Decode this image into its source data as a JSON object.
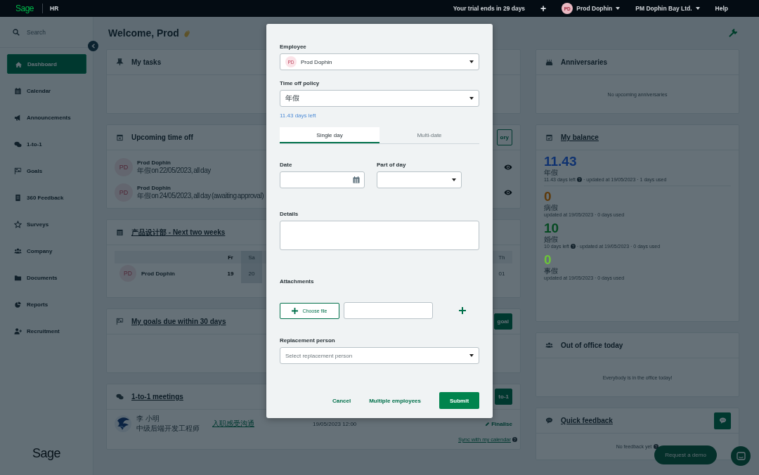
{
  "topbar": {
    "logo": "Sage",
    "product": "HR",
    "trial": "Your trial ends in 29 days",
    "add": "+",
    "user": {
      "initials": "PD",
      "name": "Prod Dophin"
    },
    "company": "PM Dophin Bay Ltd.",
    "help": "Help"
  },
  "sidebar": {
    "search_placeholder": "Search",
    "items": [
      {
        "label": "Dashboard",
        "selected": true
      },
      {
        "label": "Calendar",
        "selected": false
      },
      {
        "label": "Announcements",
        "selected": false
      },
      {
        "label": "1-to-1",
        "selected": false
      },
      {
        "label": "Goals",
        "selected": false
      },
      {
        "label": "360 Feedback",
        "selected": false
      },
      {
        "label": "Surveys",
        "selected": false
      },
      {
        "label": "Company",
        "selected": false
      },
      {
        "label": "Documents",
        "selected": false
      },
      {
        "label": "Reports",
        "selected": false
      },
      {
        "label": "Recruitment",
        "selected": false
      }
    ],
    "footer_logo": "Sage"
  },
  "welcome": "Welcome, Prod",
  "middle_cards": [
    {
      "kind": "tasks",
      "title": "My tasks",
      "link": false
    },
    {
      "kind": "time_off",
      "title": "Upcoming time off",
      "link": false,
      "action": {
        "label": "ory",
        "kind": "outline"
      },
      "rows": [
        {
          "initials": "PD",
          "name": "Prod Dophin",
          "detail": "年假 on 22/05/2023, all day"
        },
        {
          "initials": "PD",
          "name": "Prod Dophin",
          "detail": "年假 on 24/05/2023, all day (awaiting approval)"
        }
      ]
    },
    {
      "kind": "team_calendar",
      "title": "产品设计部 - Next two weeks",
      "link": true,
      "days": [
        {
          "label": "Fr",
          "date": "19",
          "today": true,
          "weekend": false
        },
        {
          "label": "Sa",
          "date": "20",
          "today": false,
          "weekend": true
        },
        {
          "label": "Th",
          "date": "01",
          "today": false,
          "weekend": false
        }
      ],
      "rows": [
        {
          "initials": "PD",
          "name": "Prod Dophin"
        }
      ]
    },
    {
      "kind": "goals",
      "title": "My goals due within 30 days",
      "link": true,
      "action": {
        "label": "goal",
        "kind": "filled"
      }
    },
    {
      "kind": "meetings",
      "title": "1-to-1 meetings",
      "link": true,
      "action": {
        "label": "to-1",
        "kind": "filled"
      },
      "rows": [
        {
          "name": "李 小明",
          "role": "中级后端开发工程师",
          "topic": "入职感受沟通",
          "time": "19/05/2023 12:00",
          "status": "Finalise"
        }
      ],
      "sync": "Sync with my calendar"
    }
  ],
  "right_cards": [
    {
      "kind": "anniversaries",
      "title": "Anniversaries",
      "link": false,
      "empty": "No upcoming anniversaries"
    },
    {
      "kind": "balance",
      "title": "My balance",
      "link": true,
      "entries": [
        {
          "amount": "11.43",
          "color": "#0f3270",
          "policy": "年假",
          "days_left": "11.43 days left",
          "updated": "· updated at 19/05/2023 · 1 days used"
        },
        {
          "amount": "0",
          "color": "#5e3a0c",
          "policy": "病假",
          "updated": "updated at 19/05/2023 · 0 days used"
        },
        {
          "amount": "10",
          "color": "#064a22",
          "policy": "婚假",
          "days_left": "10 days left",
          "updated": "· updated at 19/05/2023 · 0 days used"
        },
        {
          "amount": "0",
          "color": "#6cc43a",
          "policy": "事假",
          "updated": "updated at 19/05/2023 · 0 days used"
        }
      ]
    },
    {
      "kind": "out_of_office",
      "title": "Out of office today",
      "link": false,
      "empty": "Everybody is in the office today!"
    },
    {
      "kind": "feedback",
      "title": "Quick feedback",
      "link": true,
      "empty": "No feedback yet"
    }
  ],
  "request_demo": "Request a demo",
  "dialog": {
    "employee": {
      "label": "Employee",
      "initials": "PD",
      "value": "Prod Dophin"
    },
    "policy": {
      "label": "Time off policy",
      "value": "年假",
      "hint": "11.43 days left"
    },
    "tabs": [
      {
        "label": "Single day",
        "selected": true
      },
      {
        "label": "Multi-date",
        "selected": false
      }
    ],
    "date": {
      "label": "Date"
    },
    "part_of_day": {
      "label": "Part of day"
    },
    "details": {
      "label": "Details"
    },
    "attachments": {
      "label": "Attachments",
      "button": "Choose file"
    },
    "replacement": {
      "label": "Replacement person",
      "placeholder": "Select replacement person"
    },
    "actions": [
      "Cancel",
      "Multiple employees"
    ],
    "submit": "Submit"
  }
}
